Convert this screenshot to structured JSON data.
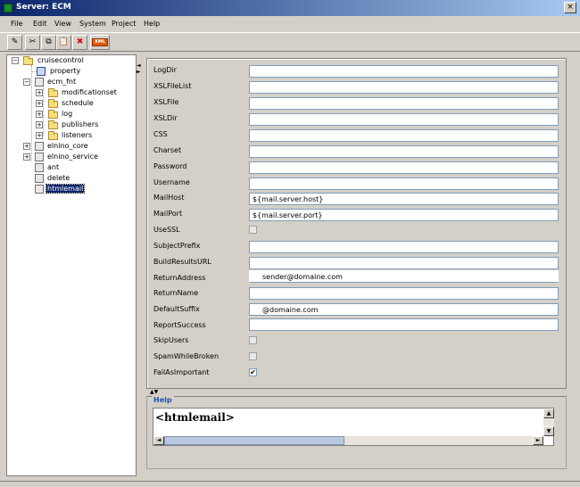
{
  "window": {
    "title": "Server: ECM",
    "close_glyph": "×"
  },
  "menu": [
    {
      "id": "file",
      "label": "File"
    },
    {
      "id": "edit",
      "label": "Edit"
    },
    {
      "id": "view",
      "label": "View"
    },
    {
      "id": "system",
      "label": "System"
    },
    {
      "id": "project",
      "label": "Project"
    },
    {
      "id": "help",
      "label": "Help"
    }
  ],
  "toolbar": {
    "icons": [
      "edit-icon",
      "cut-icon",
      "copy-icon",
      "paste-icon",
      "delete-icon",
      "xml-icon"
    ],
    "glyphs": [
      "✎",
      "✂",
      "⧉",
      "📋",
      "✖"
    ],
    "xml_label": "XML"
  },
  "tree": {
    "nodes": [
      {
        "label": "cruisecontrol",
        "expander": "−"
      },
      {
        "label": "property"
      },
      {
        "label": "ecm_fnt",
        "expander": "−"
      },
      {
        "label": "modificationset",
        "expander": "+"
      },
      {
        "label": "schedule",
        "expander": "+"
      },
      {
        "label": "log",
        "expander": "+"
      },
      {
        "label": "publishers",
        "expander": "+"
      },
      {
        "label": "listeners",
        "expander": "+"
      },
      {
        "label": "elnino_core",
        "expander": "+"
      },
      {
        "label": "elnino_service",
        "expander": "+"
      },
      {
        "label": "ant"
      },
      {
        "label": "delete"
      },
      {
        "label": "htmlemail"
      }
    ]
  },
  "properties": [
    {
      "label": "LogDir",
      "value": ""
    },
    {
      "label": "XSLFileList",
      "value": ""
    },
    {
      "label": "XSLFile",
      "value": ""
    },
    {
      "label": "XSLDir",
      "value": ""
    },
    {
      "label": "CSS",
      "value": ""
    },
    {
      "label": "Charset",
      "value": ""
    },
    {
      "label": "Password",
      "value": ""
    },
    {
      "label": "Username",
      "value": ""
    },
    {
      "label": "MailHost",
      "value": "${mail.server.host}"
    },
    {
      "label": "MailPort",
      "value": "${mail.server.port}"
    },
    {
      "label": "UseSSL",
      "checked": false
    },
    {
      "label": "SubjectPrefix",
      "value": ""
    },
    {
      "label": "BuildResultsURL",
      "value": ""
    },
    {
      "label": "ReturnAddress",
      "value": "sender@domaine.com"
    },
    {
      "label": "ReturnName",
      "value": ""
    },
    {
      "label": "DefaultSuffix",
      "value": "@domaine.com"
    },
    {
      "label": "ReportSuccess",
      "value": ""
    },
    {
      "label": "SkipUsers",
      "checked": false
    },
    {
      "label": "SpamWhileBroken",
      "checked": false
    },
    {
      "label": "FailAsImportant",
      "checked": true,
      "mark": "✔"
    }
  ],
  "help": {
    "title": "Help",
    "content": "<htmlemail>"
  },
  "scroll_glyphs": {
    "up": "▲",
    "down": "▼",
    "left": "◄",
    "right": "►"
  },
  "splitter_glyphs": {
    "vertical": "◄\n►",
    "horizontal": "▲▼"
  }
}
